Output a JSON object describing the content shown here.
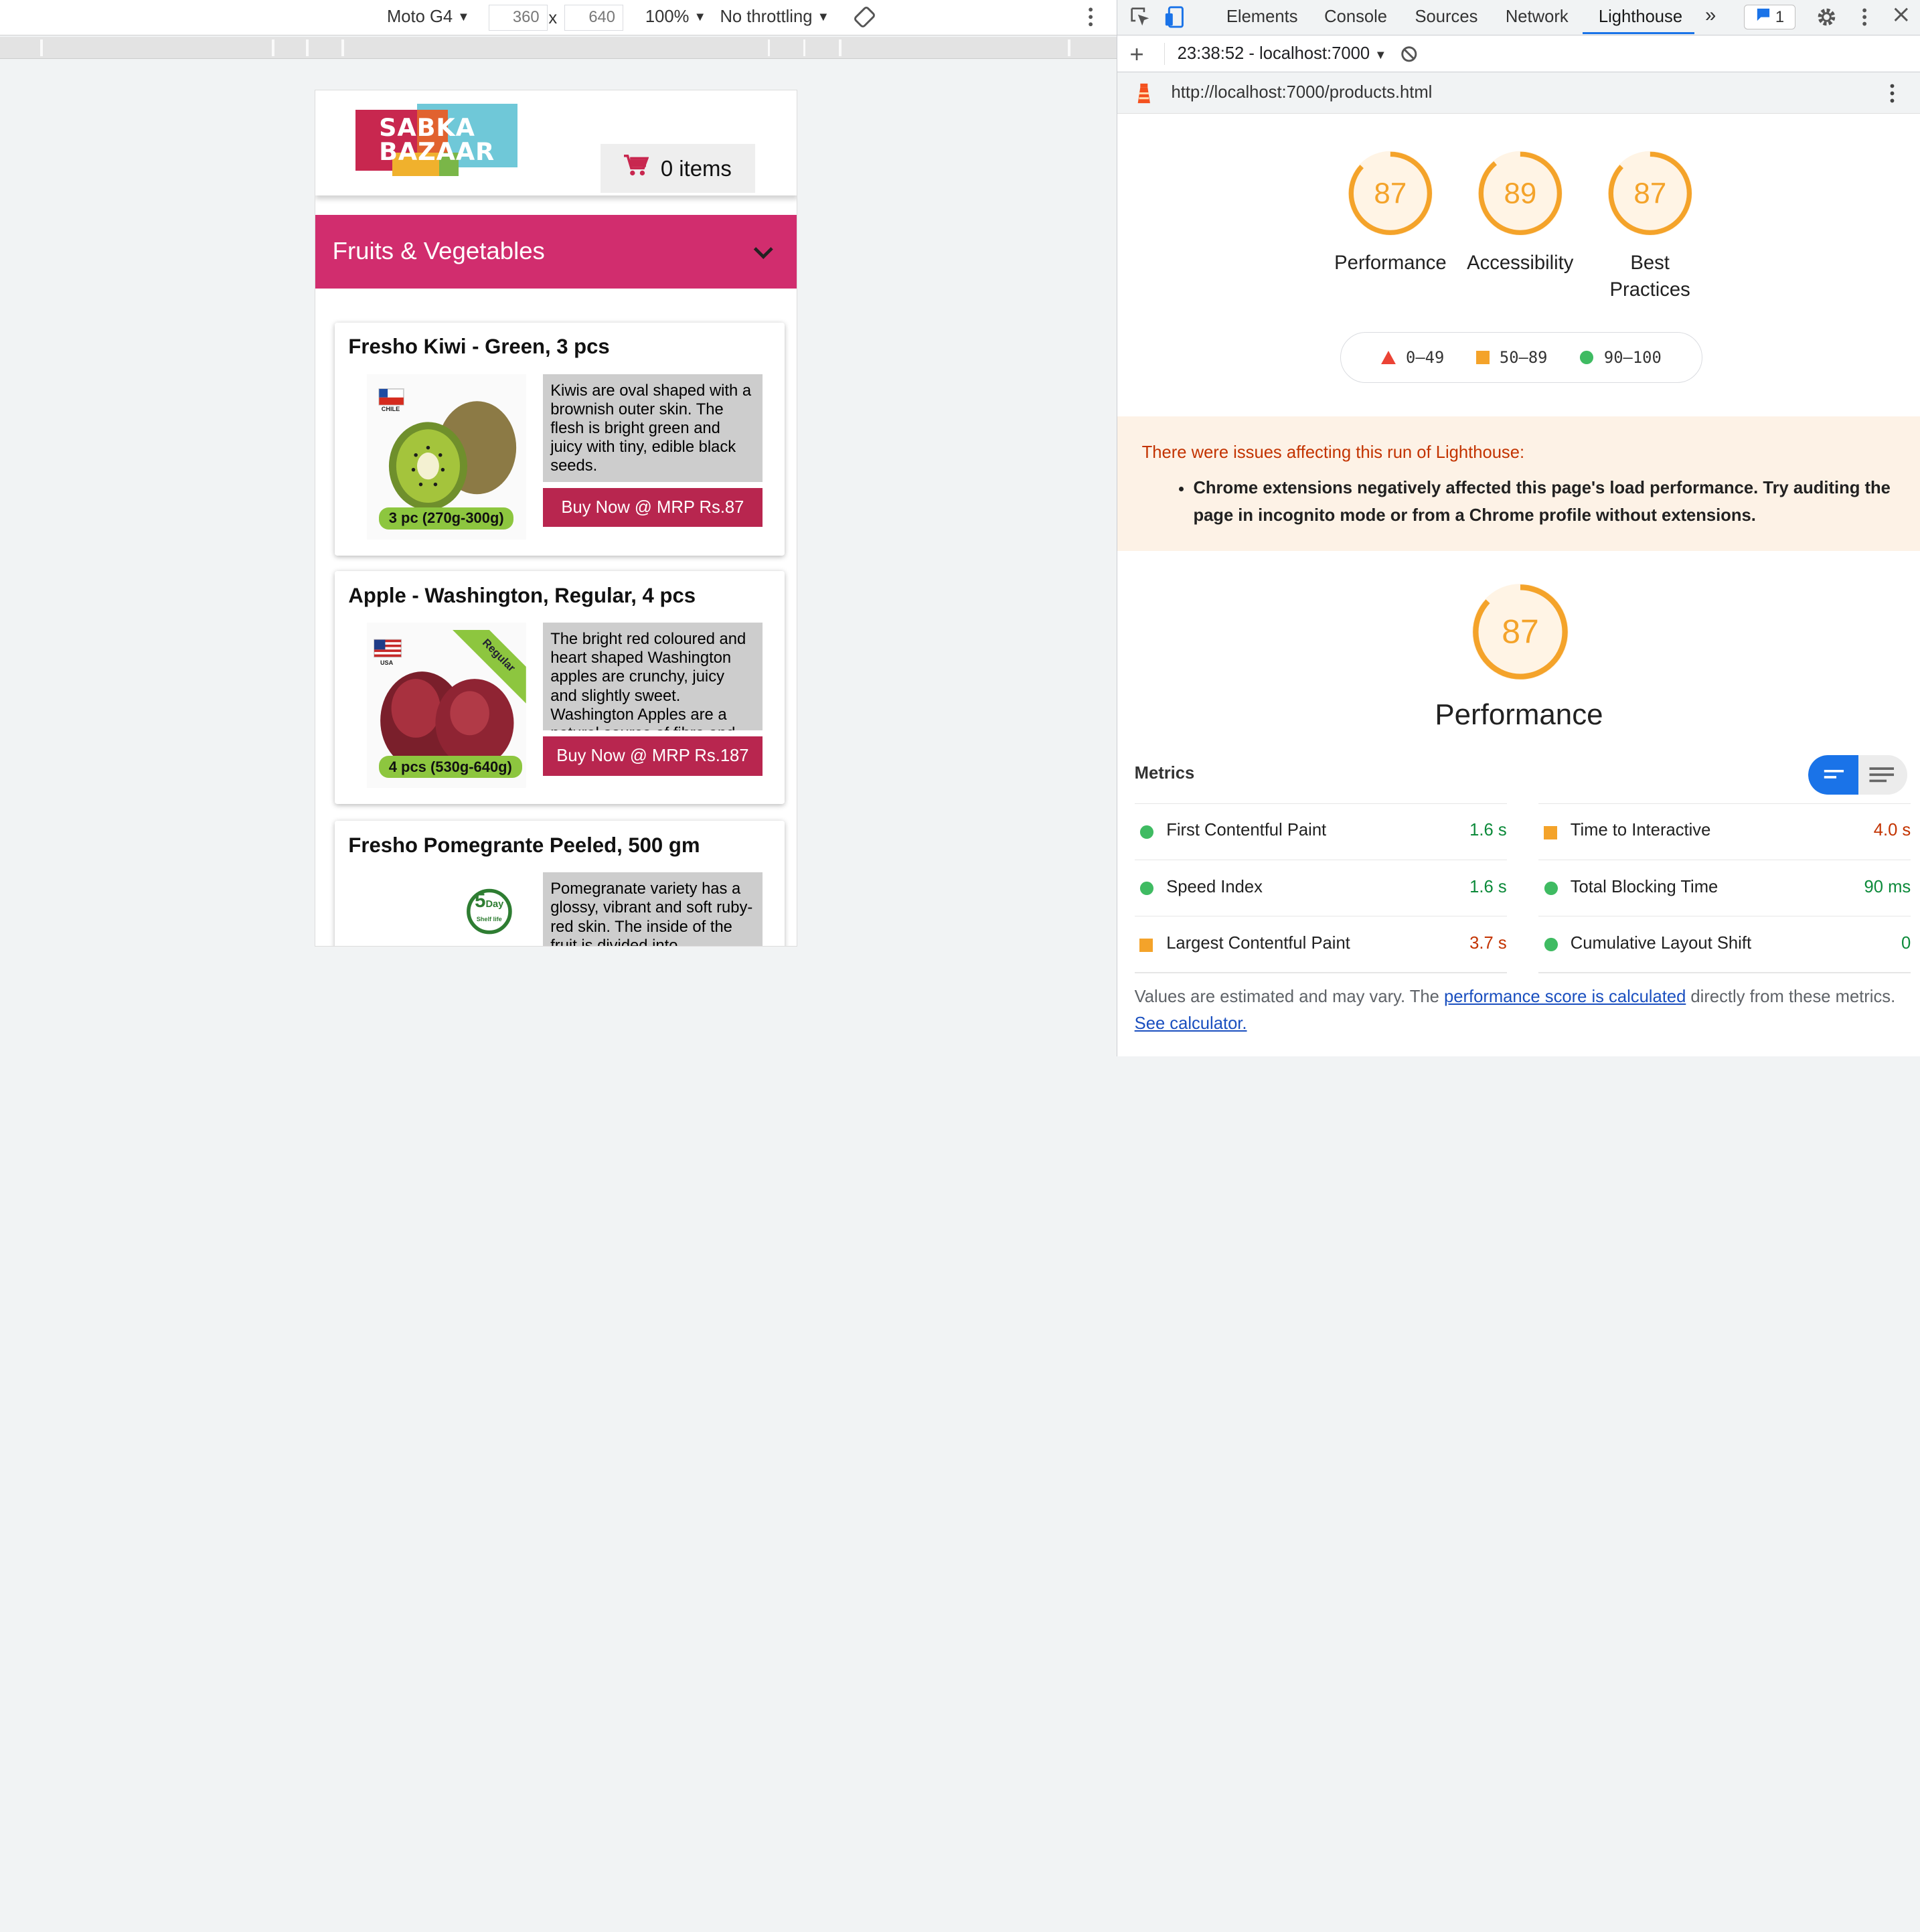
{
  "device_toolbar": {
    "device": "Moto G4",
    "width": "360",
    "height": "640",
    "times": "x",
    "zoom": "100%",
    "throttling": "No throttling"
  },
  "phone": {
    "logo_line1": "SABKA",
    "logo_line2": "BAZAAR",
    "cart_label": "0 items",
    "category": "Fruits & Vegetables",
    "products": [
      {
        "name": "Fresho Kiwi - Green, 3 pcs",
        "description": "Kiwis are oval shaped with a brownish outer skin. The flesh is bright green and juicy with tiny, edible black seeds.",
        "buy": "Buy Now @ MRP Rs.87",
        "badge": "3 pc (270g-300g)",
        "origin": "CHILE"
      },
      {
        "name": "Apple - Washington, Regular, 4 pcs",
        "description": "The bright red coloured and heart shaped Washington apples are crunchy, juicy and slightly sweet. Washington Apples are a natural source of fibre and",
        "buy": "Buy Now @ MRP Rs.187",
        "badge": "4 pcs (530g-640g)",
        "origin": "USA",
        "ribbon": "Regular"
      },
      {
        "name": "Fresho Pomegrante Peeled, 500 gm",
        "description": "Pomegranate variety has a glossy, vibrant and soft ruby-red skin. The inside of the fruit is divided into",
        "shelf_day": "5",
        "shelf_word": "Day",
        "shelf_life": "Shelf life"
      }
    ]
  },
  "devtools": {
    "tabs": [
      "Elements",
      "Console",
      "Sources",
      "Network",
      "Lighthouse"
    ],
    "active_tab": "Lighthouse",
    "more": "»",
    "messages": "1",
    "report_select": "23:38:52 - localhost:7000",
    "url": "http://localhost:7000/products.html",
    "scores": [
      {
        "label": "Performance",
        "value": 87
      },
      {
        "label": "Accessibility",
        "value": 89
      },
      {
        "label": "Best Practices",
        "value": 87
      }
    ],
    "legend": [
      {
        "range": "0–49",
        "color": "#eb4335"
      },
      {
        "range": "50–89",
        "color": "#f4a32a"
      },
      {
        "range": "90–100",
        "color": "#3fbb62"
      }
    ],
    "warning_title": "There were issues affecting this run of Lighthouse:",
    "warning_item": "Chrome extensions negatively affected this page's load performance. Try auditing the page in incognito mode or from a Chrome profile without extensions.",
    "perf_score": 87,
    "perf_title": "Performance",
    "metrics_label": "Metrics",
    "metrics": [
      {
        "name": "First Contentful Paint",
        "value": "1.6 s",
        "status": "pass"
      },
      {
        "name": "Time to Interactive",
        "value": "4.0 s",
        "status": "average"
      },
      {
        "name": "Speed Index",
        "value": "1.6 s",
        "status": "pass"
      },
      {
        "name": "Total Blocking Time",
        "value": "90 ms",
        "status": "pass"
      },
      {
        "name": "Largest Contentful Paint",
        "value": "3.7 s",
        "status": "average"
      },
      {
        "name": "Cumulative Layout Shift",
        "value": "0",
        "status": "pass"
      }
    ],
    "note_prefix": "Values are estimated and may vary. The ",
    "note_link1": "performance score is calculated",
    "note_middle": " directly from these metrics. ",
    "note_link2": "See calculator."
  },
  "colors": {
    "pass": "#0c8a3a",
    "average": "#c33300",
    "gauge_orange": "#f4a32a",
    "brand_pink": "#d12d6e"
  }
}
